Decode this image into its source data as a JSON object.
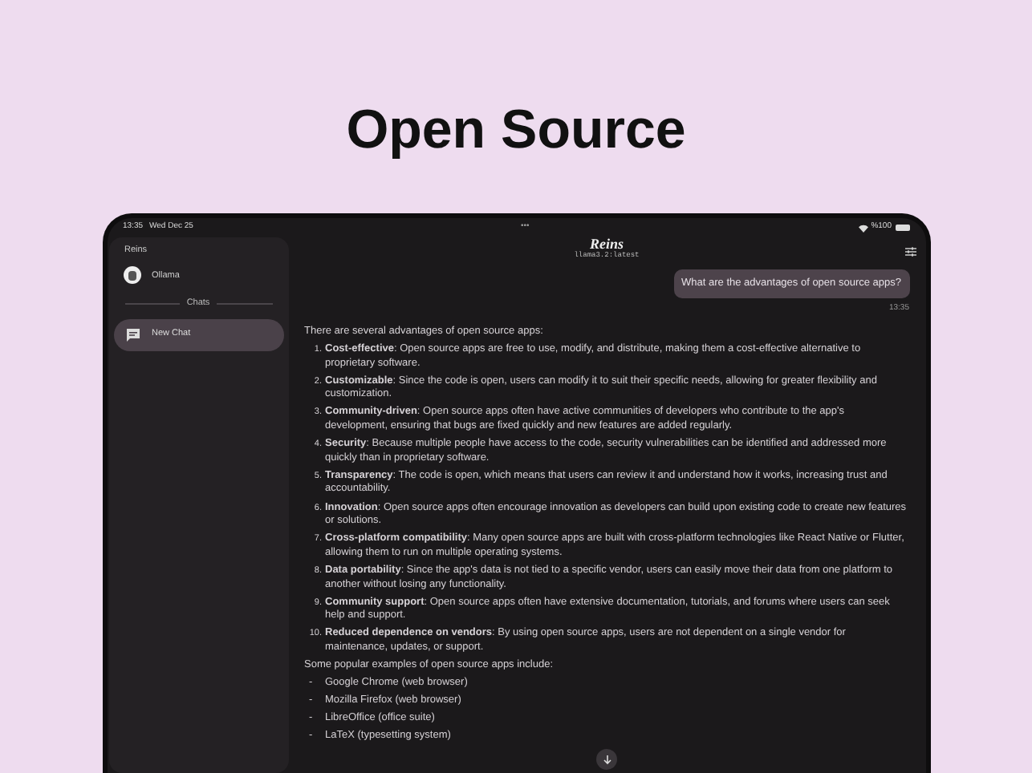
{
  "headline": "Open Source",
  "status_bar": {
    "time": "13:35",
    "date": "Wed Dec 25",
    "dots": "•••",
    "battery": "%100"
  },
  "sidebar": {
    "title": "Reins",
    "providers": [
      {
        "label": "Ollama"
      }
    ],
    "section": "Chats",
    "chats": [
      {
        "label": "New Chat",
        "selected": true
      }
    ]
  },
  "header": {
    "title": "Reins",
    "model": "llama3.2:latest"
  },
  "user_message": {
    "text": "What are the advantages of open source apps?",
    "time": "13:35"
  },
  "assistant_message": {
    "intro": "There are several advantages of open source apps:",
    "points": [
      {
        "number": "1.",
        "text": "**Cost-effective**: Open source apps are free to use, modify, and distribute, making them a cost-effective alternative to proprietary software."
      },
      {
        "number": "2.",
        "text": "**Customizable**: Since the code is open, users can modify it to suit their specific needs, allowing for greater flexibility and customization."
      },
      {
        "number": "3.",
        "text": "**Community-driven**: Open source apps often have active communities of developers who contribute to the app's development, ensuring that bugs are fixed quickly and new features are added regularly."
      },
      {
        "number": "4.",
        "text": "**Security**: Because multiple people have access to the code, security vulnerabilities can be identified and addressed more quickly than in proprietary software."
      },
      {
        "number": "5.",
        "text": "**Transparency**: The code is open, which means that users can review it and understand how it works, increasing trust and accountability."
      },
      {
        "number": "6.",
        "text": "**Innovation**: Open source apps often encourage innovation as developers can build upon existing code to create new features or solutions."
      },
      {
        "number": "7.",
        "text": "**Cross-platform compatibility**: Many open source apps are built with cross-platform technologies like React Native or Flutter, allowing them to run on multiple operating systems."
      },
      {
        "number": "8.",
        "text": "**Data portability**: Since the app's data is not tied to a specific vendor, users can easily move their data from one platform to another without losing any functionality."
      },
      {
        "number": "9.",
        "text": "**Community support**: Open source apps often have extensive documentation, tutorials, and forums where users can seek help and support."
      },
      {
        "number": "10.",
        "text": "**Reduced dependence on vendors**: By using open source apps, users are not dependent on a single vendor for maintenance, updates, or support."
      }
    ],
    "outro": "Some popular examples of open source apps include:",
    "examples": [
      {
        "bullet": "-",
        "text": "Google Chrome (web browser)"
      },
      {
        "bullet": "-",
        "text": "Mozilla Firefox (web browser)"
      },
      {
        "bullet": "-",
        "text": "LibreOffice (office suite)"
      },
      {
        "bullet": "-",
        "text": "LaTeX (typesetting system)"
      }
    ]
  }
}
